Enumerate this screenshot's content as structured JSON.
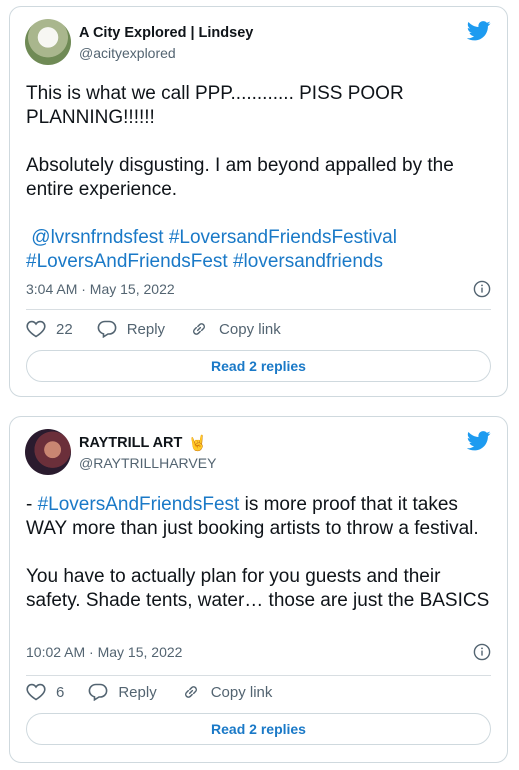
{
  "tweets": [
    {
      "author_name": "A City Explored | Lindsey",
      "author_handle": "@acityexplored",
      "name_emoji": "",
      "text_para1": "This is what we call PPP............ PISS POOR PLANNING!!!!!!",
      "text_para2": "Absolutely disgusting. I am beyond appalled by the entire experience.",
      "hashtags_line1": " @lvrsnfrndsfest #LoversandFriendsFestival",
      "hashtags_line2": "#LoversAndFriendsFest #loversandfriends",
      "timestamp": "3:04 AM · May 15, 2022",
      "like_count": "22",
      "reply_label": "Reply",
      "copy_label": "Copy link",
      "read_replies_label": "Read 2 replies"
    },
    {
      "author_name": "RAYTRILL ART",
      "author_handle": "@RAYTRILLHARVEY",
      "name_emoji": "🤘",
      "text_hashtag": "#LoversAndFriendsFest",
      "text_prefix": "- ",
      "text_after": " is more proof that it takes WAY more than just booking artists to throw a festival.",
      "text_para2": "You have to actually plan for you guests and their safety. Shade tents, water… those are just the BASICS",
      "timestamp": "10:02 AM · May 15, 2022",
      "like_count": "6",
      "reply_label": "Reply",
      "copy_label": "Copy link",
      "read_replies_label": "Read 2 replies"
    }
  ],
  "colors": {
    "twitter_blue": "#1d9bf0",
    "link_blue": "#1a79c7",
    "muted_text": "#536471",
    "border": "#cfd9de"
  },
  "icons": [
    "twitter-bird-icon",
    "heart-icon",
    "reply-icon",
    "copy-link-icon",
    "info-icon"
  ]
}
